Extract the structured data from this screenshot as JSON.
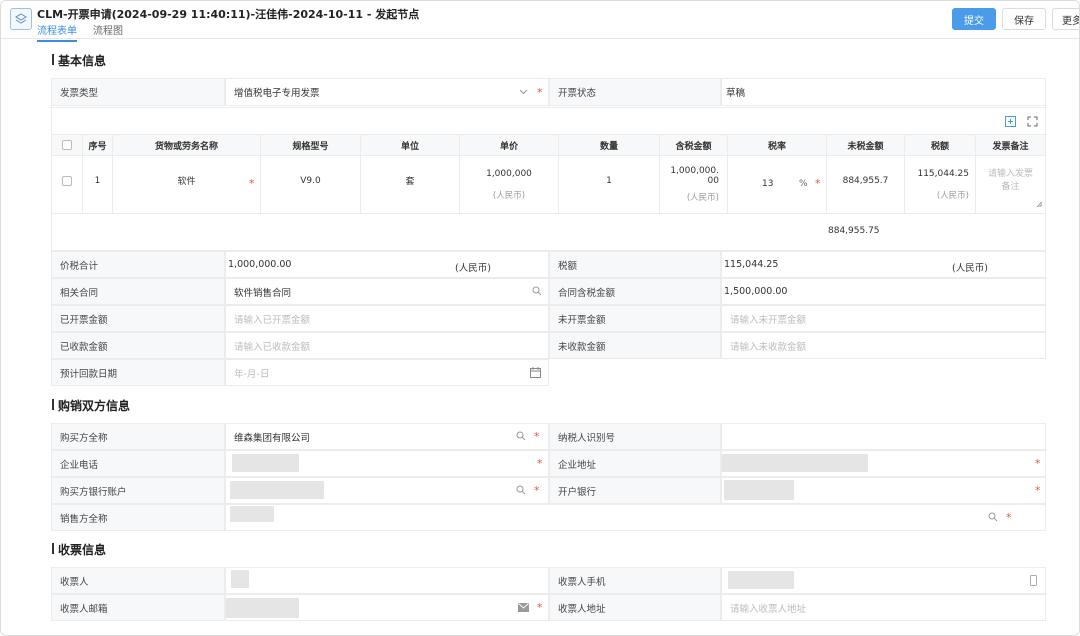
{
  "header": {
    "title": "CLM-开票申请(2024-09-29 11:40:11)-汪佳伟-2024-10-11 - 发起节点",
    "tabs": [
      "流程表单",
      "流程图"
    ],
    "submit_label": "提交",
    "save_label": "保存",
    "more_label": "更多"
  },
  "basic": {
    "section_title": "基本信息",
    "invoice_type_label": "发票类型",
    "invoice_type_value": "增值税电子专用发票",
    "invoice_status_label": "开票状态",
    "invoice_status_value": "草稿",
    "table": {
      "headers": [
        "序号",
        "货物或劳务名称",
        "规格型号",
        "单位",
        "单价",
        "数量",
        "含税金额",
        "税率",
        "未税金额",
        "税额",
        "发票备注"
      ],
      "row": {
        "index": "1",
        "name": "软件",
        "spec": "V9.0",
        "unit": "套",
        "price": "1,000,000",
        "price_currency": "(人民币)",
        "qty": "1",
        "amount_line1": "1,000,000.",
        "amount_line2": "00",
        "amount_currency": "(人民币)",
        "tax_rate": "13",
        "tax_rate_unit": "%",
        "untaxed": "884,955.7",
        "tax": "115,044.25",
        "tax_currency": "(人民币)",
        "note_placeholder_1": "请输入发票",
        "note_placeholder_2": "备注"
      },
      "untaxed_total": "884,955.75"
    },
    "total_label": "价税合计",
    "total_value": "1,000,000.00",
    "total_currency": "(人民币)",
    "tax_label": "税额",
    "tax_value": "115,044.25",
    "tax_currency": "(人民币)",
    "contract_label": "相关合同",
    "contract_value": "软件销售合同",
    "contract_amount_label": "合同含税金额",
    "contract_amount_value": "1,500,000.00",
    "invoiced_label": "已开票金额",
    "invoiced_placeholder": "请输入已开票金额",
    "uninvoiced_label": "未开票金额",
    "uninvoiced_placeholder": "请输入未开票金额",
    "received_label": "已收款金额",
    "received_placeholder": "请输入已收款金额",
    "unreceived_label": "未收款金额",
    "unreceived_placeholder": "请输入未收款金额",
    "expected_date_label": "预计回款日期",
    "expected_date_placeholder": "年-月-日"
  },
  "parties": {
    "section_title": "购销双方信息",
    "buyer_label": "购买方全称",
    "buyer_value": "维森集团有限公司",
    "taxpayer_label": "纳税人识别号",
    "phone_label": "企业电话",
    "address_label": "企业地址",
    "bank_account_label": "购买方银行账户",
    "bank_label": "开户银行",
    "seller_label": "销售方全称"
  },
  "receiver": {
    "section_title": "收票信息",
    "name_label": "收票人",
    "phone_label": "收票人手机",
    "email_label": "收票人邮箱",
    "address_label": "收票人地址",
    "address_placeholder": "请输入收票人地址"
  },
  "colors": {
    "accent": "#4a9be9",
    "required": "#e6553a",
    "label_bg": "#f7f8fa"
  }
}
